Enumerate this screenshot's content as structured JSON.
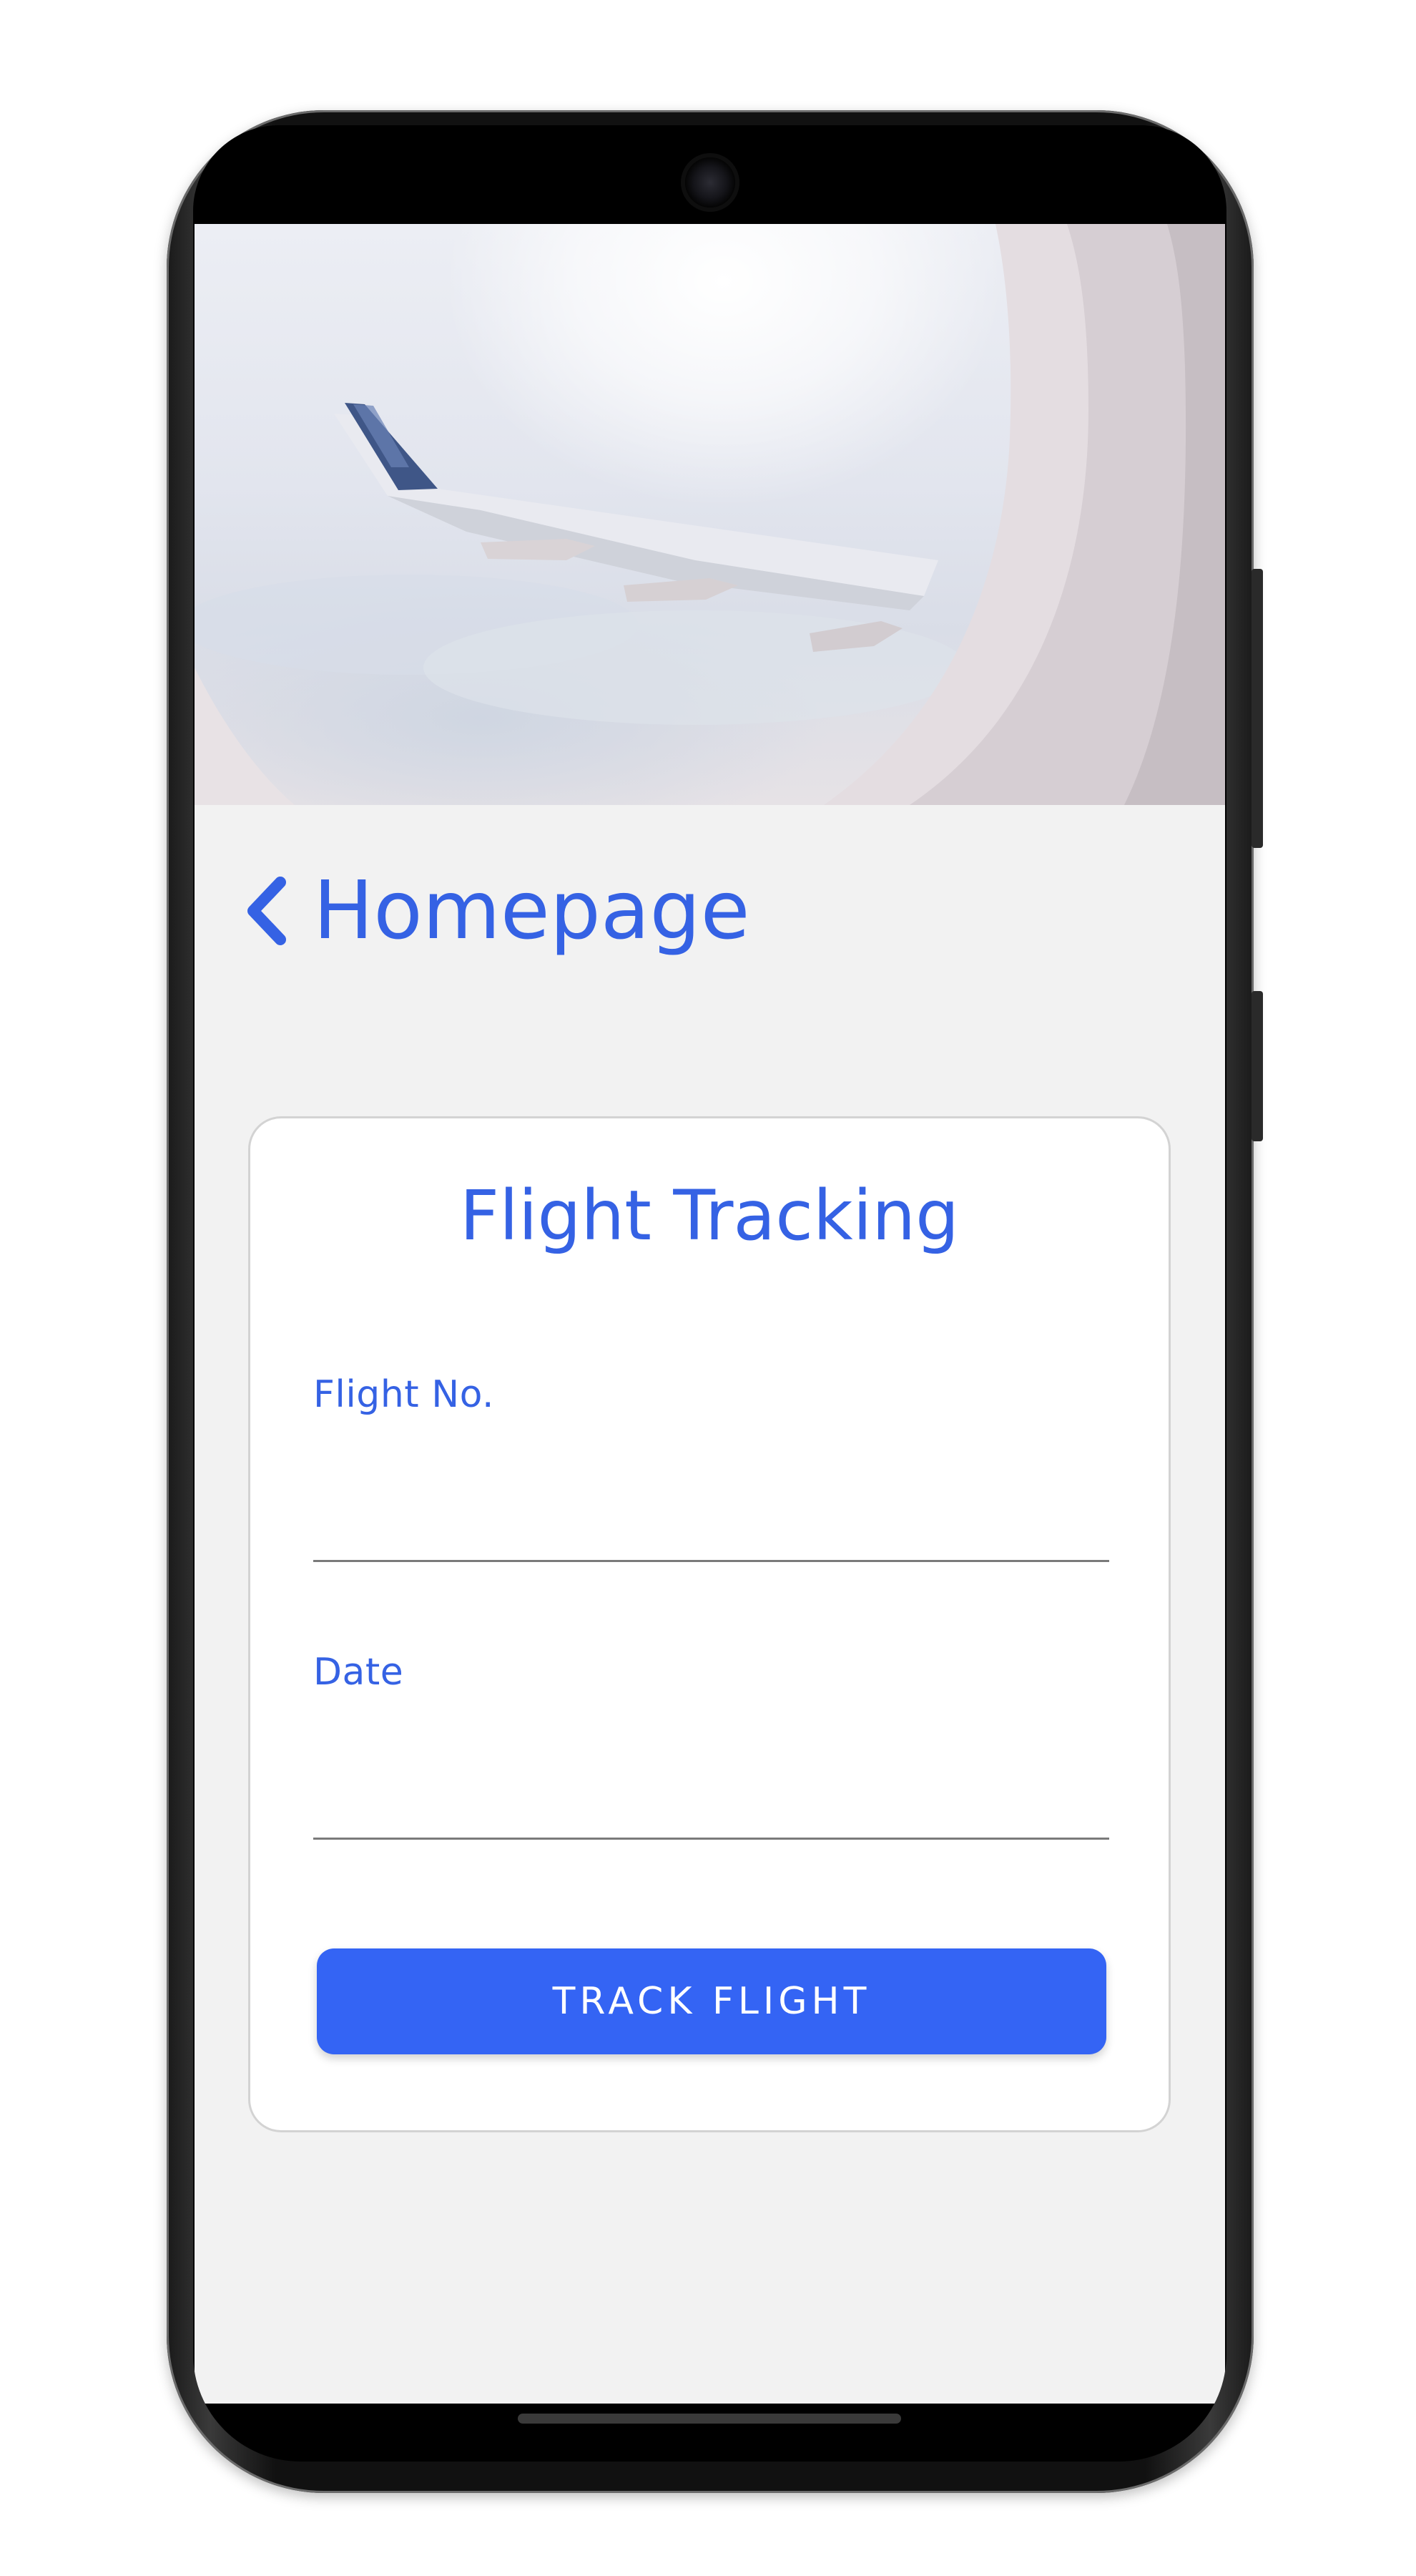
{
  "header": {
    "back_label": "Homepage",
    "back_icon": "chevron-left-icon"
  },
  "hero": {
    "image": "airplane-window-wing-photo"
  },
  "form": {
    "title": "Flight Tracking",
    "flight_no": {
      "label": "Flight No.",
      "value": "",
      "placeholder": ""
    },
    "date": {
      "label": "Date",
      "value": "",
      "placeholder": ""
    },
    "submit_label": "TRACK FLIGHT"
  },
  "colors": {
    "accent": "#3562e4",
    "button": "#3464f4",
    "background": "#f2f2f2",
    "card": "#ffffff"
  }
}
